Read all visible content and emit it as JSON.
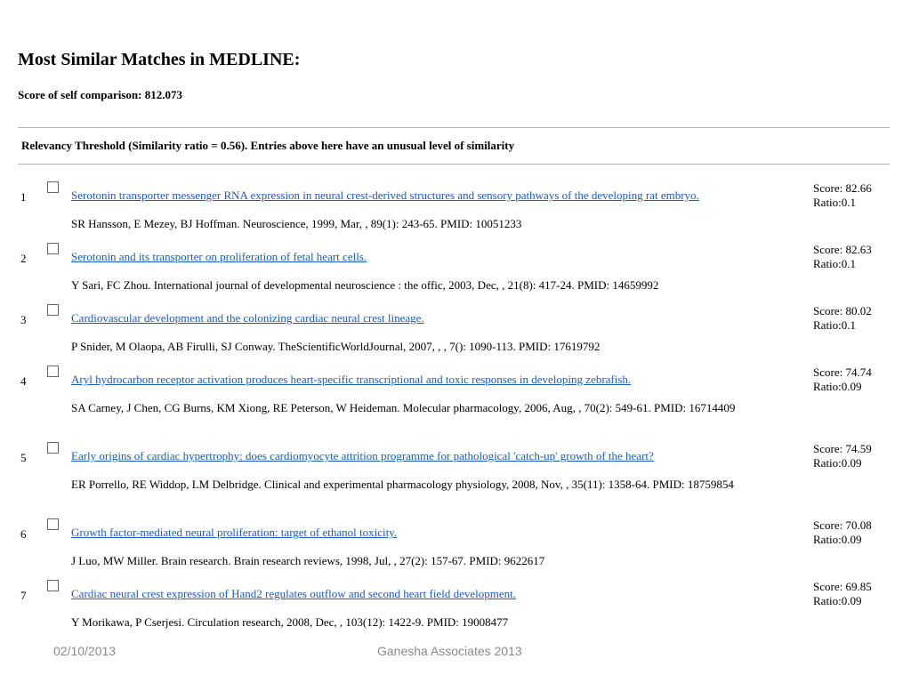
{
  "heading": "Most Similar Matches in MEDLINE:",
  "self_comparison": "Score of self comparison: 812.073",
  "threshold_note": "Relevancy Threshold (Similarity ratio = 0.56). Entries above here have an unusual level of similarity",
  "results": [
    {
      "num": "1",
      "title": "Serotonin transporter messenger RNA expression in neural crest-derived structures and sensory pathways of the developing rat embryo.",
      "citation": "SR Hansson, E Mezey, BJ Hoffman. Neuroscience, 1999, Mar, , 89(1): 243-65.    PMID: 10051233",
      "score": "Score: 82.66",
      "ratio": "Ratio:0.1"
    },
    {
      "num": "2",
      "title": "Serotonin and its transporter on proliferation of fetal heart cells.",
      "citation": "Y Sari, FC Zhou. International journal of developmental neuroscience : the offic, 2003, Dec, , 21(8): 417-24.    PMID: 14659992",
      "score": "Score: 82.63",
      "ratio": "Ratio:0.1"
    },
    {
      "num": "3",
      "title": "Cardiovascular development and the colonizing cardiac neural crest lineage.",
      "citation": "P Snider, M Olaopa, AB Firulli, SJ Conway. TheScientificWorldJournal, 2007, , , 7(): 1090-113.    PMID: 17619792",
      "score": "Score: 80.02",
      "ratio": "Ratio:0.1"
    },
    {
      "num": "4",
      "title": "Aryl hydrocarbon receptor activation produces heart-specific transcriptional and toxic responses in developing zebrafish.",
      "citation": "SA Carney, J Chen, CG Burns, KM Xiong, RE Peterson, W Heideman. Molecular pharmacology, 2006, Aug, , 70(2): 549-61.    PMID: 16714409",
      "score": "Score: 74.74",
      "ratio": "Ratio:0.09"
    },
    {
      "num": "5",
      "title": "Early origins of cardiac hypertrophy: does cardiomyocyte attrition programme for pathological 'catch-up' growth of the heart?",
      "citation": "ER Porrello, RE Widdop, LM Delbridge. Clinical and experimental pharmacology physiology, 2008, Nov, , 35(11): 1358-64.    PMID: 18759854",
      "score": "Score: 74.59",
      "ratio": "Ratio:0.09"
    },
    {
      "num": "6",
      "title": "Growth factor-mediated neural proliferation: target of ethanol toxicity.",
      "citation": "J Luo, MW Miller. Brain research. Brain research reviews, 1998, Jul, , 27(2): 157-67.    PMID: 9622617",
      "score": "Score: 70.08",
      "ratio": "Ratio:0.09"
    },
    {
      "num": "7",
      "title": "Cardiac neural crest expression of Hand2 regulates outflow and second heart field development.",
      "citation": "Y Morikawa, P Cserjesi. Circulation research, 2008, Dec, , 103(12): 1422-9.    PMID: 19008477",
      "score": "Score: 69.85",
      "ratio": "Ratio:0.09"
    }
  ],
  "footer": {
    "date": "02/10/2013",
    "org": "Ganesha Associates 2013"
  },
  "colors": {
    "link": "#1a5bbf",
    "footer_text": "#8a8a8a",
    "divider": "#b3b3b3"
  }
}
